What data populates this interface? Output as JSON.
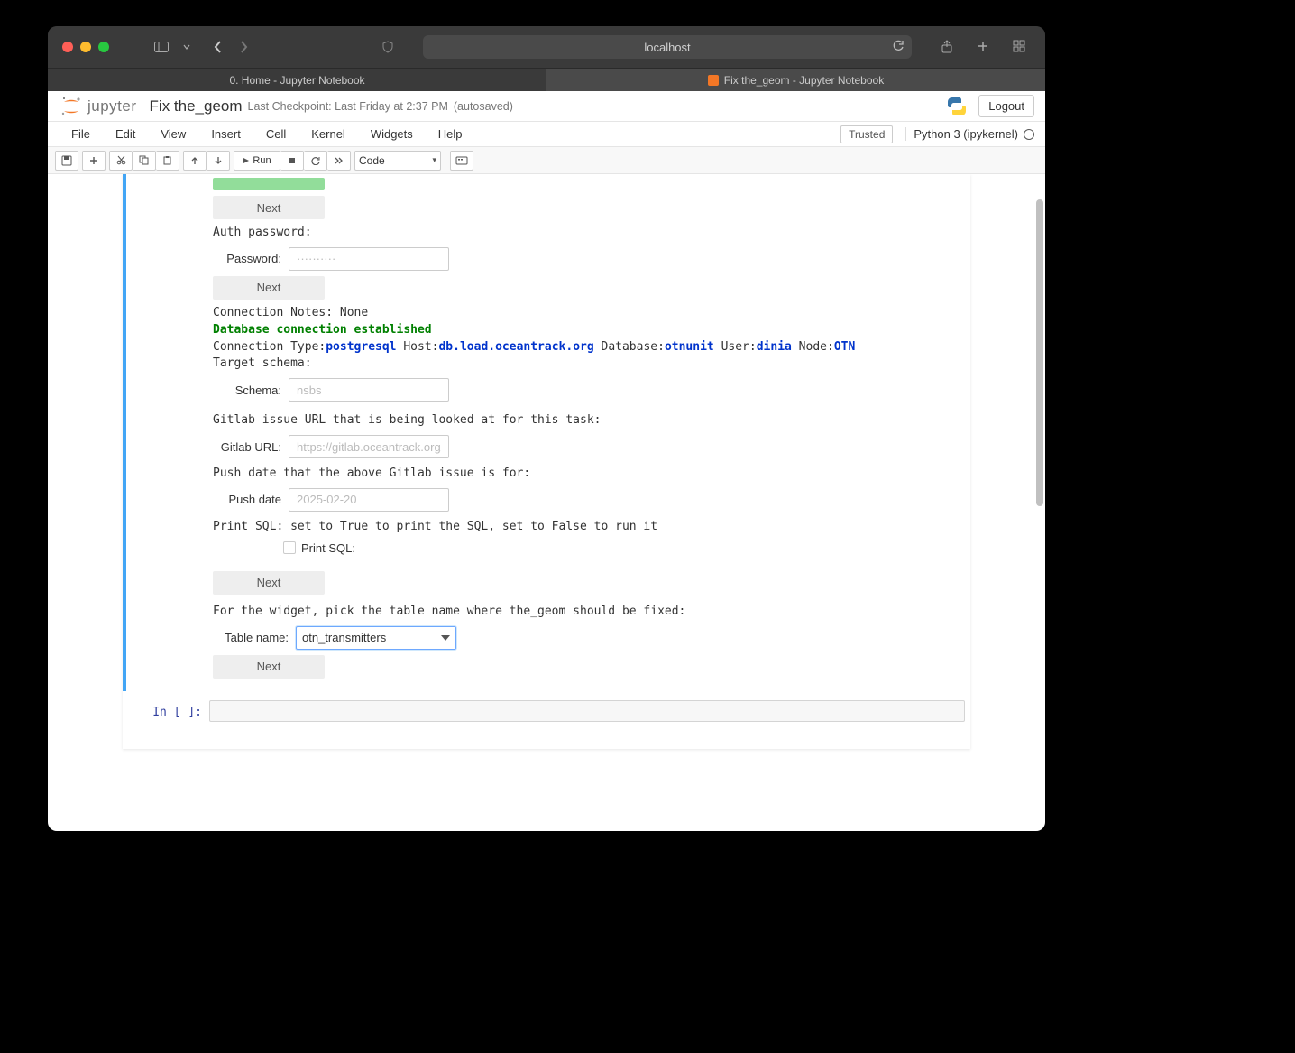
{
  "browser": {
    "url": "localhost",
    "tabs": [
      {
        "title": "0. Home - Jupyter Notebook",
        "active": false
      },
      {
        "title": "Fix the_geom - Jupyter Notebook",
        "active": true
      }
    ]
  },
  "header": {
    "logo_text": "jupyter",
    "notebook_name": "Fix the_geom",
    "checkpoint": "Last Checkpoint: Last Friday at 2:37 PM",
    "autosave": "(autosaved)",
    "logout": "Logout"
  },
  "menu": [
    "File",
    "Edit",
    "View",
    "Insert",
    "Cell",
    "Kernel",
    "Widgets",
    "Help"
  ],
  "trusted": "Trusted",
  "kernel": "Python 3 (ipykernel)",
  "toolbar": {
    "run": "Run",
    "celltype": "Code"
  },
  "output": {
    "auth_password_prompt": "Auth password:",
    "password_label": "Password:",
    "password_placeholder": "··········",
    "next": "Next",
    "conn_notes": "Connection Notes: None",
    "db_established": "Database connection established",
    "conn_line_prefix": "Connection Type:",
    "conn_type": "postgresql",
    "host_label": " Host:",
    "host": "db.load.oceantrack.org",
    "db_label": " Database:",
    "db": "otnunit",
    "user_label": " User:",
    "user": "dinia",
    "node_label": " Node:",
    "node": "OTN",
    "target_schema": "Target schema:",
    "schema_label": "Schema:",
    "schema_placeholder": "nsbs",
    "gitlab_prompt": "Gitlab issue URL that is being looked at for this task:",
    "gitlab_label": "Gitlab URL:",
    "gitlab_placeholder": "https://gitlab.oceantrack.org/otn-",
    "pushdate_prompt": "Push date that the above Gitlab issue is for:",
    "pushdate_label": "Push date",
    "pushdate_placeholder": "2025-02-20",
    "printsql_prompt": "Print SQL: set to True to print the SQL, set to False to run it",
    "printsql_label": "Print SQL:",
    "tablepick_prompt": "For the widget, pick the table name where the_geom should be fixed:",
    "table_label": "Table name:",
    "table_value": "otn_transmitters"
  },
  "empty_prompt": "In [ ]:"
}
